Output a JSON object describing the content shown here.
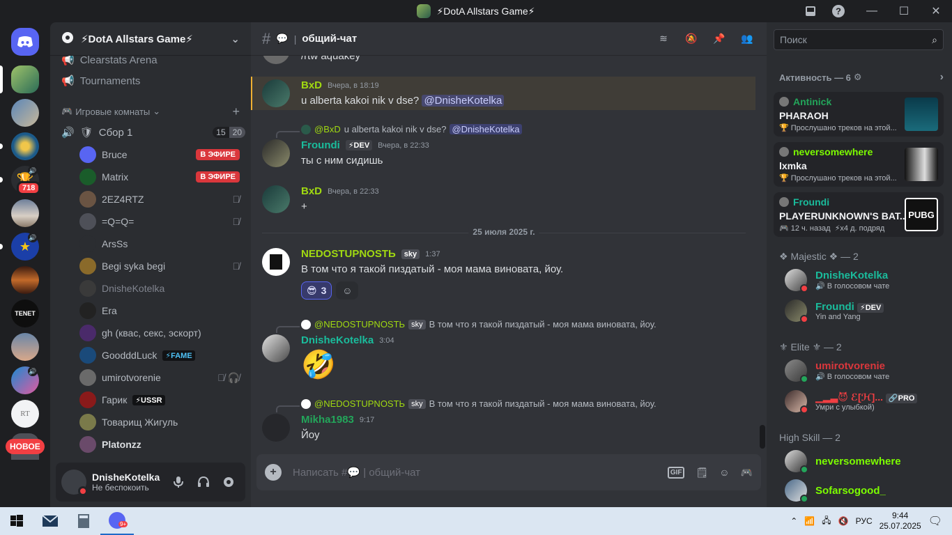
{
  "window": {
    "title": "⚡DotA Allstars Game⚡"
  },
  "rail": {
    "badge": "718",
    "new_label": "НОВОЕ",
    "tenet_label": "TENET"
  },
  "sidebar": {
    "guild_name": "⚡DotA Allstars Game⚡",
    "cut_channel": "Clearstats Arena",
    "tournaments": "Tournaments",
    "category": "Игровые комнаты",
    "voice_channel": "Сбор 1",
    "voice_count_a": "15",
    "voice_count_b": "20",
    "live_label": "В ЭФИРЕ",
    "members": [
      {
        "name": "Bruce"
      },
      {
        "name": "Matrix"
      },
      {
        "name": "2EZ4RTZ"
      },
      {
        "name": "=Q=Q="
      },
      {
        "name": "ArsSs"
      },
      {
        "name": "Begi syka begi"
      },
      {
        "name": "DnisheKotelka"
      },
      {
        "name": "Era"
      },
      {
        "name": "gh (квас, секс, эскорт)"
      },
      {
        "name": "GoodddLuck",
        "tag": "⚡FAME"
      },
      {
        "name": "umirotvorenie"
      },
      {
        "name": "Гарик",
        "tag": "⚡USSR"
      },
      {
        "name": "Товарищ Жигуль"
      },
      {
        "name": "Platonzz"
      }
    ]
  },
  "user": {
    "name": "DnisheKotelka",
    "status": "Не беспокоить"
  },
  "chat": {
    "channel": "общий-чат",
    "channel_prefix": "💬",
    "cut_text": "/rtw aquakey",
    "messages": [
      {
        "author": "BxD",
        "time": "Вчера, в 18:19",
        "text": "u alberta kakoi nik v dse?",
        "mention": "@DnisheKotelka"
      },
      {
        "reply_author": "@BxD",
        "reply_text": "u alberta kakoi nik v dse?",
        "reply_mention": "@DnisheKotelka",
        "author": "Froundi",
        "tag": "⚡DEV",
        "time": "Вчера, в 22:33",
        "text": "ты с ним сидишь"
      },
      {
        "author": "BxD",
        "time": "Вчера, в 22:33",
        "text": "+"
      },
      {
        "author": "NEDOSTUPNOSTЬ",
        "tag": "sky",
        "time": "1:37",
        "text": "В том что я такой пиздатый - моя мама виновата, йоу.",
        "reaction": "😎",
        "reaction_count": "3"
      },
      {
        "reply_author": "@NEDOSTUPNOSTЬ",
        "reply_tag": "sky",
        "reply_text": "В том что я такой пиздатый - моя мама виновата, йоу.",
        "author": "DnisheKotelka",
        "time": "3:04",
        "emoji": "🤣"
      },
      {
        "reply_author": "@NEDOSTUPNOSTЬ",
        "reply_tag": "sky",
        "reply_text": "В том что я такой пиздатый - моя мама виновата, йоу.",
        "author": "Mikha1983",
        "time": "9:17",
        "text": "Йоу"
      }
    ],
    "date_divider": "25 июля 2025 г.",
    "placeholder_a": "Написать #",
    "placeholder_b": "общий-чат"
  },
  "right": {
    "search_placeholder": "Поиск",
    "activity_header": "Активность — 6",
    "cards": [
      {
        "user": "Antinick",
        "title": "PHARAOH",
        "sub": "Прослушано треков на этой..."
      },
      {
        "user": "neversomewhere",
        "title": "lxmka",
        "sub": "Прослушано треков на этой..."
      },
      {
        "user": "Froundi",
        "title": "PLAYERUNKNOWN'S BAT...",
        "sub": "12 ч. назад",
        "sub2": "x4 д. подряд",
        "art": "PUBG"
      }
    ],
    "groups": [
      {
        "label": "❖ Majestic ❖ — 2",
        "members": [
          {
            "name": "DnisheKotelka",
            "sub": "В голосовом чате"
          },
          {
            "name": "Froundi",
            "tag": "⚡DEV",
            "sub": "Yin and Yang"
          }
        ]
      },
      {
        "label": "⚜ Elite ⚜ — 2",
        "members": [
          {
            "name": "umirotvorenie",
            "sub": "В голосовом чате"
          },
          {
            "name": "▁▂▃😈 ℰ[ℋ]...",
            "tag": "🔗PRO",
            "sub": "Умри с улыбкой)"
          }
        ]
      },
      {
        "label": "High Skill — 2",
        "members": [
          {
            "name": "neversomewhere"
          },
          {
            "name": "Sofarsogood_"
          }
        ]
      }
    ]
  },
  "taskbar": {
    "lang": "РУС",
    "time": "9:44",
    "date": "25.07.2025",
    "badge": "9+"
  },
  "colors": {
    "green": "#23a55a",
    "cyan": "#1abc9c",
    "lime": "#7cfc00",
    "red": "#f23f43",
    "accent": "#5865f2"
  }
}
